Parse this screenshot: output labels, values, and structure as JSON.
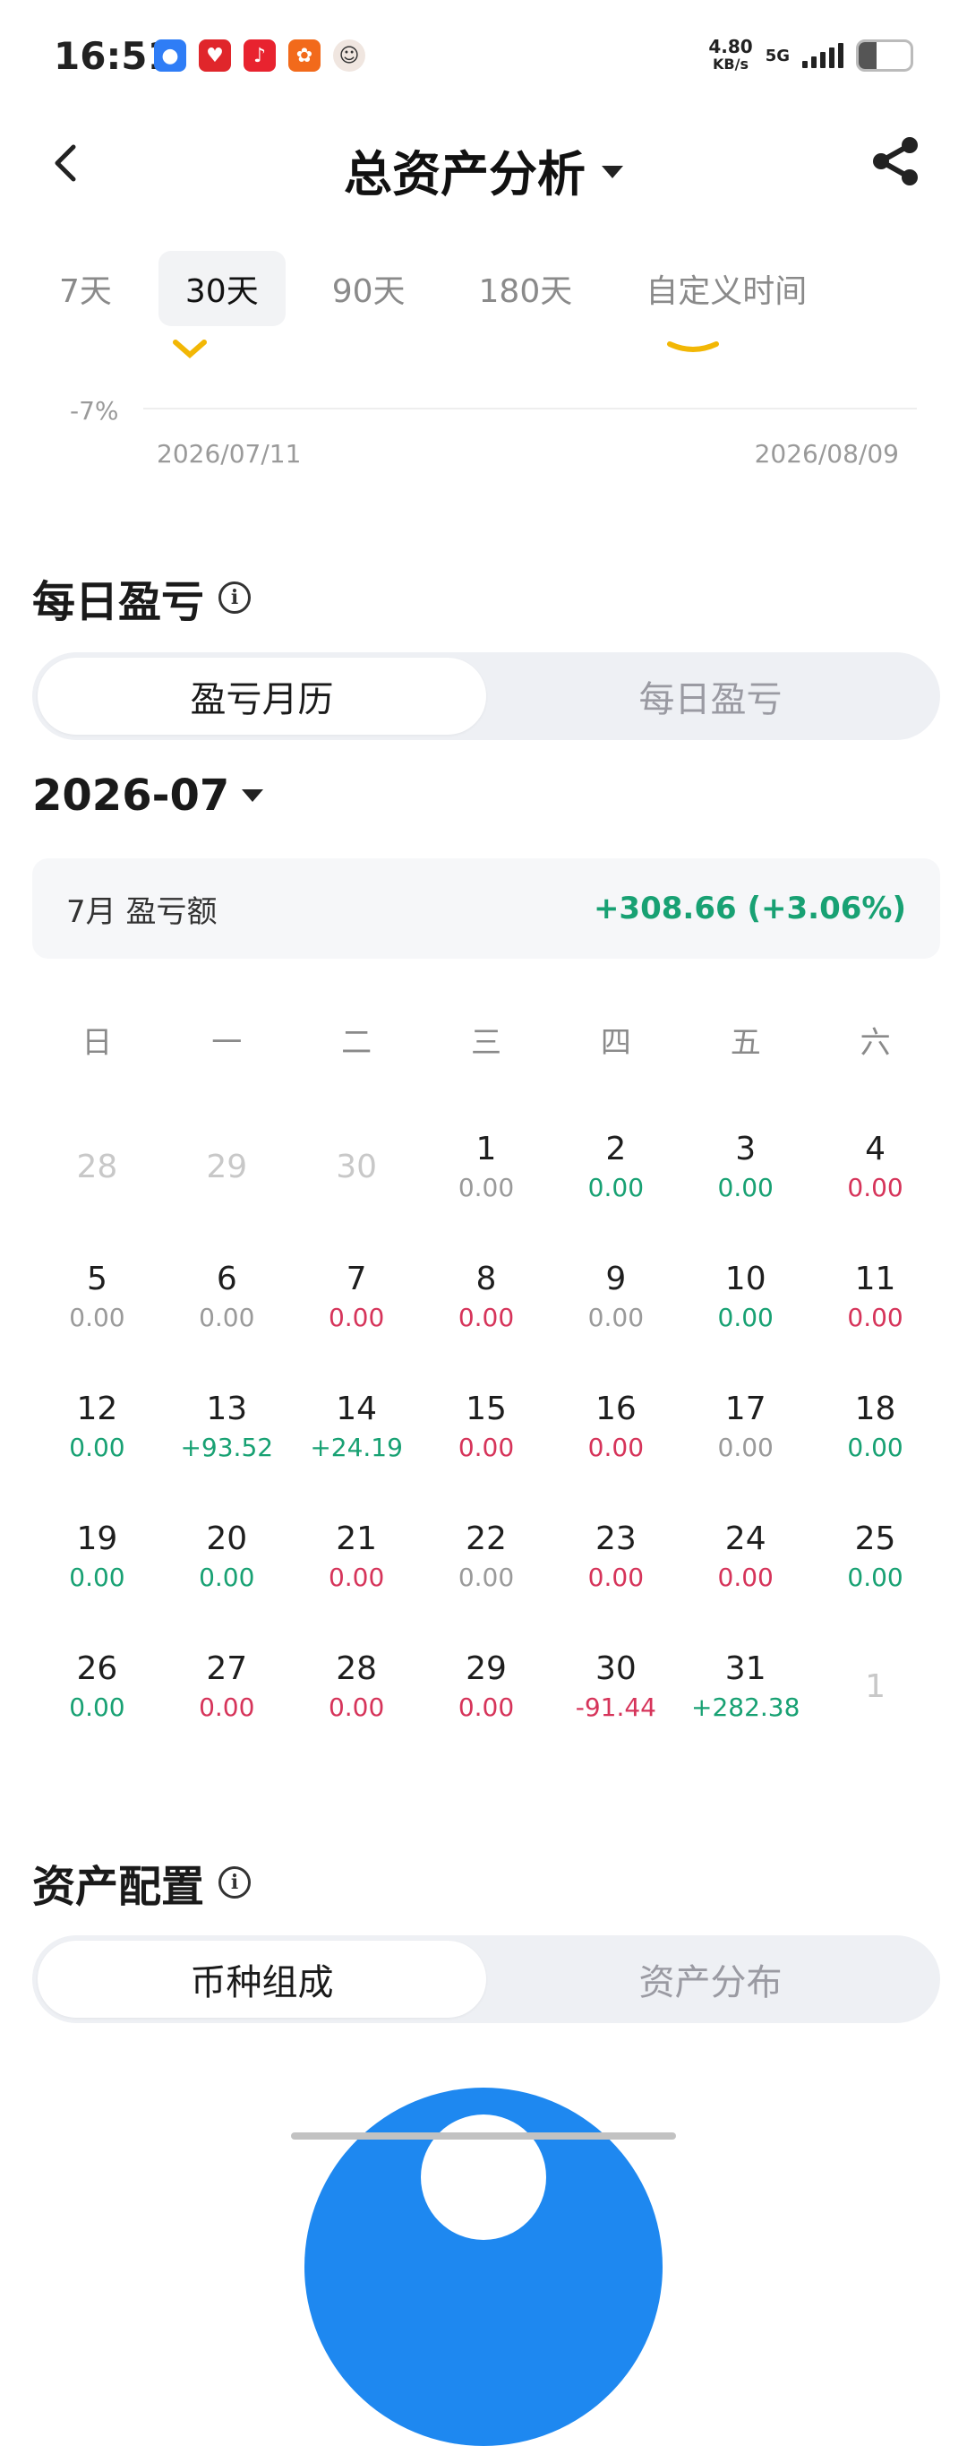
{
  "status_bar": {
    "time": "16:51",
    "net_speed_value": "4.80",
    "net_speed_unit": "KB/s",
    "network": "5G"
  },
  "header": {
    "title": "总资产分析"
  },
  "range_tabs": [
    {
      "label": "7天",
      "active": false
    },
    {
      "label": "30天",
      "active": true
    },
    {
      "label": "90天",
      "active": false
    },
    {
      "label": "180天",
      "active": false
    },
    {
      "label": "自定义时间",
      "active": false
    }
  ],
  "chart": {
    "y_label": "-7%",
    "x_start": "2026/07/11",
    "x_end": "2026/08/09"
  },
  "daily_pnl": {
    "section_title": "每日盈亏",
    "seg_calendar": "盈亏月历",
    "seg_daily": "每日盈亏",
    "month": "2026-07",
    "summary_label": "7月 盈亏额",
    "summary_value": "+308.66 (+3.06%)",
    "weekdays": [
      "日",
      "一",
      "二",
      "三",
      "四",
      "五",
      "六"
    ],
    "days": [
      {
        "day": "28",
        "value": "",
        "tone": "muted"
      },
      {
        "day": "29",
        "value": "",
        "tone": "muted"
      },
      {
        "day": "30",
        "value": "",
        "tone": "muted"
      },
      {
        "day": "1",
        "value": "0.00",
        "tone": "gray"
      },
      {
        "day": "2",
        "value": "0.00",
        "tone": "green"
      },
      {
        "day": "3",
        "value": "0.00",
        "tone": "green"
      },
      {
        "day": "4",
        "value": "0.00",
        "tone": "red"
      },
      {
        "day": "5",
        "value": "0.00",
        "tone": "gray"
      },
      {
        "day": "6",
        "value": "0.00",
        "tone": "gray"
      },
      {
        "day": "7",
        "value": "0.00",
        "tone": "red"
      },
      {
        "day": "8",
        "value": "0.00",
        "tone": "red"
      },
      {
        "day": "9",
        "value": "0.00",
        "tone": "gray"
      },
      {
        "day": "10",
        "value": "0.00",
        "tone": "green"
      },
      {
        "day": "11",
        "value": "0.00",
        "tone": "red"
      },
      {
        "day": "12",
        "value": "0.00",
        "tone": "green"
      },
      {
        "day": "13",
        "value": "+93.52",
        "tone": "green"
      },
      {
        "day": "14",
        "value": "+24.19",
        "tone": "green"
      },
      {
        "day": "15",
        "value": "0.00",
        "tone": "red"
      },
      {
        "day": "16",
        "value": "0.00",
        "tone": "red"
      },
      {
        "day": "17",
        "value": "0.00",
        "tone": "gray"
      },
      {
        "day": "18",
        "value": "0.00",
        "tone": "green"
      },
      {
        "day": "19",
        "value": "0.00",
        "tone": "green"
      },
      {
        "day": "20",
        "value": "0.00",
        "tone": "green"
      },
      {
        "day": "21",
        "value": "0.00",
        "tone": "red"
      },
      {
        "day": "22",
        "value": "0.00",
        "tone": "gray"
      },
      {
        "day": "23",
        "value": "0.00",
        "tone": "red"
      },
      {
        "day": "24",
        "value": "0.00",
        "tone": "red"
      },
      {
        "day": "25",
        "value": "0.00",
        "tone": "green"
      },
      {
        "day": "26",
        "value": "0.00",
        "tone": "green"
      },
      {
        "day": "27",
        "value": "0.00",
        "tone": "red"
      },
      {
        "day": "28",
        "value": "0.00",
        "tone": "red"
      },
      {
        "day": "29",
        "value": "0.00",
        "tone": "red"
      },
      {
        "day": "30",
        "value": "-91.44",
        "tone": "red"
      },
      {
        "day": "31",
        "value": "+282.38",
        "tone": "green"
      },
      {
        "day": "1",
        "value": "",
        "tone": "muted"
      }
    ]
  },
  "asset_allocation": {
    "section_title": "资产配置",
    "seg_currency": "币种组成",
    "seg_distribution": "资产分布"
  },
  "colors": {
    "green": "#18a173",
    "red": "#d6345a",
    "accent_blue": "#1e88f0",
    "chart_yellow": "#f2b705"
  }
}
